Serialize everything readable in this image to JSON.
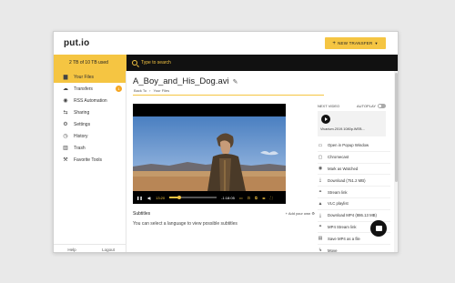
{
  "header": {
    "logo": "put.io",
    "new_transfer_label": "NEW TRANSFER"
  },
  "storage": {
    "text": "2 TB of 10 TB used"
  },
  "search": {
    "placeholder": "Type to search"
  },
  "sidebar": {
    "items": [
      {
        "label": "Your Files",
        "icon": "folder-icon",
        "glyph": "▆",
        "active": true
      },
      {
        "label": "Transfers",
        "icon": "cloud-download-icon",
        "glyph": "☁",
        "badge": "1"
      },
      {
        "label": "RSS Automation",
        "icon": "rss-icon",
        "glyph": "◉"
      },
      {
        "label": "Sharing",
        "icon": "share-icon",
        "glyph": "⇆"
      },
      {
        "label": "Settings",
        "icon": "gear-icon",
        "glyph": "⚙"
      },
      {
        "label": "History",
        "icon": "history-icon",
        "glyph": "◷"
      },
      {
        "label": "Trash",
        "icon": "trash-icon",
        "glyph": "▥"
      },
      {
        "label": "Favorite Tools",
        "icon": "tools-icon",
        "glyph": "⚒"
      }
    ],
    "footer": {
      "help": "Help",
      "logout": "Logout"
    }
  },
  "file": {
    "title": "A_Boy_and_His_Dog.avi",
    "breadcrumb_back": "Back To",
    "breadcrumb_folder": "Your Files"
  },
  "player": {
    "current_time": "13:20",
    "remaining_time": "-1:18:05",
    "progress": 0.2
  },
  "subtitles": {
    "heading": "Subtitles",
    "add_label": "Add your own",
    "empty_text": "You can select a language to view possible subtitles"
  },
  "next_video": {
    "label": "NEXT VIDEO",
    "autoplay_label": "AUTOPLAY",
    "filename": "Vivarium.2019.1080p.WEB..."
  },
  "actions": [
    {
      "label": "Open in Popup Window",
      "icon": "popup-window-icon",
      "glyph": "▭"
    },
    {
      "label": "Chromecast",
      "icon": "chromecast-icon",
      "glyph": "▢"
    },
    {
      "label": "Mark as Watched",
      "icon": "eye-icon",
      "glyph": "◉"
    },
    {
      "label": "Download (751.2 MB)",
      "icon": "download-icon",
      "glyph": "⤓"
    },
    {
      "label": "Stream link",
      "icon": "link-icon",
      "glyph": "⚭"
    },
    {
      "label": "VLC playlist",
      "icon": "vlc-icon",
      "glyph": "▲"
    },
    {
      "label": "Download MP4 (886.13 MB)",
      "icon": "download-mp4-icon",
      "glyph": "⤓"
    },
    {
      "label": "MP4 Stream link",
      "icon": "mp4-link-icon",
      "glyph": "⚭"
    },
    {
      "label": "Save MP4 as a file",
      "icon": "save-icon",
      "glyph": "▤"
    },
    {
      "label": "Move",
      "icon": "move-icon",
      "glyph": "↳"
    }
  ],
  "colors": {
    "accent": "#f5c542",
    "dark": "#111111"
  }
}
